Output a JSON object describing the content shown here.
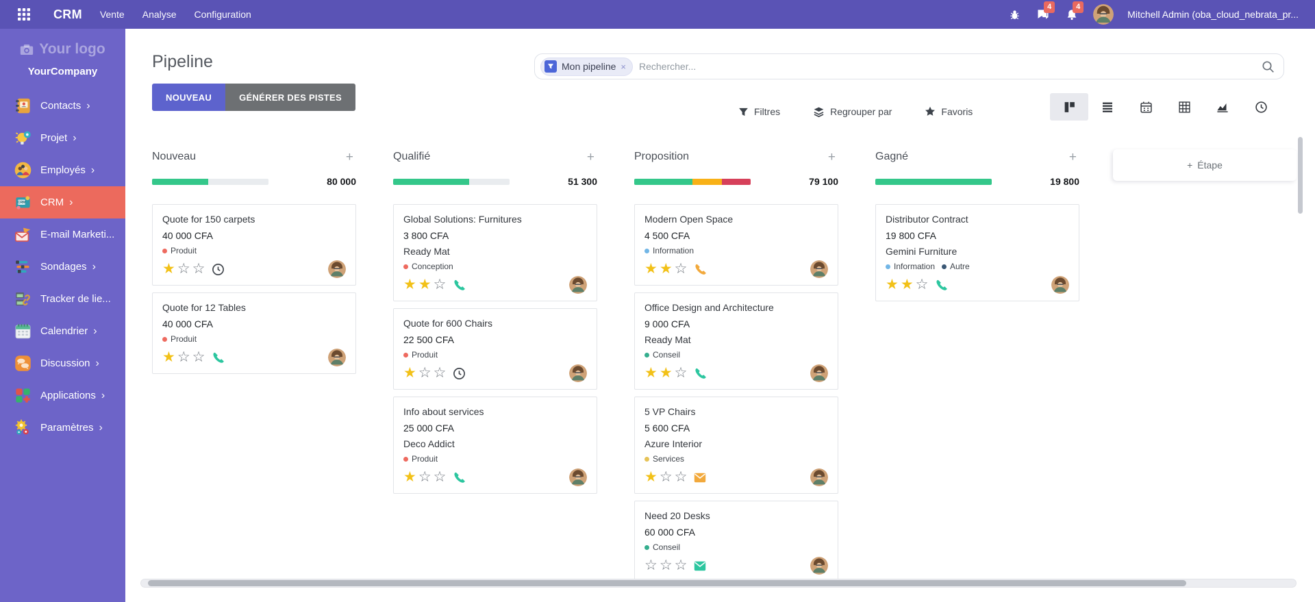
{
  "topbar": {
    "app_name": "CRM",
    "menus": [
      "Vente",
      "Analyse",
      "Configuration"
    ],
    "message_badge": "4",
    "notification_badge": "4",
    "user_name": "Mitchell Admin (oba_cloud_nebrata_pr...",
    "bar_color": "#5a53b5",
    "badge_color": "#e9695f"
  },
  "sidebar": {
    "logo_label": "Your logo",
    "company_name": "YourCompany",
    "background_color": "#6d64c8",
    "active_color": "#ec6a5d",
    "items": [
      {
        "label": "Contacts",
        "icon": "contacts-icon",
        "arrow": true,
        "active": false
      },
      {
        "label": "Projet",
        "icon": "project-icon",
        "arrow": true,
        "active": false
      },
      {
        "label": "Employés",
        "icon": "employees-icon",
        "arrow": true,
        "active": false
      },
      {
        "label": "CRM",
        "icon": "crm-icon",
        "arrow": true,
        "active": true
      },
      {
        "label": "E-mail Marketi...",
        "icon": "email-marketing-icon",
        "arrow": false,
        "active": false
      },
      {
        "label": "Sondages",
        "icon": "surveys-icon",
        "arrow": true,
        "active": false
      },
      {
        "label": "Tracker de lie...",
        "icon": "link-tracker-icon",
        "arrow": false,
        "active": false
      },
      {
        "label": "Calendrier",
        "icon": "calendar-icon",
        "arrow": true,
        "active": false
      },
      {
        "label": "Discussion",
        "icon": "discuss-icon",
        "arrow": true,
        "active": false
      },
      {
        "label": "Applications",
        "icon": "applications-icon",
        "arrow": true,
        "active": false
      },
      {
        "label": "Paramètres",
        "icon": "settings-icon",
        "arrow": true,
        "active": false
      }
    ]
  },
  "header": {
    "title": "Pipeline",
    "buttons": {
      "new": "NOUVEAU",
      "generate": "GÉNÉRER DES PISTES"
    },
    "search": {
      "facet": "Mon pipeline",
      "remove": "×",
      "placeholder": "Rechercher..."
    },
    "controls": [
      {
        "label": "Filtres",
        "icon": "filter-icon"
      },
      {
        "label": "Regrouper par",
        "icon": "layers-icon"
      },
      {
        "label": "Favoris",
        "icon": "favorite-star-icon"
      }
    ],
    "views": [
      "kanban",
      "list",
      "calendar",
      "pivot",
      "graph",
      "activity"
    ],
    "active_view": "kanban"
  },
  "kanban": {
    "add_stage": {
      "plus": "+",
      "label": "Étape"
    },
    "add_card_plus": "+",
    "max_stars": 3,
    "glyphs": {
      "star_filled": "★",
      "star_empty": "☆"
    },
    "progress_colors": {
      "green": "#34c78a",
      "orange": "#f8b117",
      "red": "#d6405a"
    },
    "tag_colors": {
      "red": "#ee6a5f",
      "lightblue": "#72b6e6",
      "teal": "#35ae8e",
      "yellow": "#e6c357",
      "navy": "#3b5875"
    },
    "activity_colors": {
      "gray": "#41464d",
      "green": "#2cc69f",
      "orange": "#f2a93c"
    },
    "columns": [
      {
        "name": "Nouveau",
        "total": "80 000",
        "progress": [
          {
            "color": "green",
            "pct": 48
          }
        ],
        "cards": [
          {
            "title": "Quote for 150 carpets",
            "amount": "40 000 CFA",
            "tags": [
              {
                "label": "Produit",
                "color": "red"
              }
            ],
            "stars": 1,
            "activity": {
              "type": "clock",
              "color": "gray"
            }
          },
          {
            "title": "Quote for 12 Tables",
            "amount": "40 000 CFA",
            "tags": [
              {
                "label": "Produit",
                "color": "red"
              }
            ],
            "stars": 1,
            "activity": {
              "type": "phone",
              "color": "green"
            }
          }
        ]
      },
      {
        "name": "Qualifié",
        "total": "51 300",
        "progress": [
          {
            "color": "green",
            "pct": 65
          }
        ],
        "cards": [
          {
            "title": "Global Solutions: Furnitures",
            "amount": "3 800 CFA",
            "partner": "Ready Mat",
            "tags": [
              {
                "label": "Conception",
                "color": "red"
              }
            ],
            "stars": 2,
            "activity": {
              "type": "phone",
              "color": "green"
            }
          },
          {
            "title": "Quote for 600 Chairs",
            "amount": "22 500 CFA",
            "tags": [
              {
                "label": "Produit",
                "color": "red"
              }
            ],
            "stars": 1,
            "activity": {
              "type": "clock",
              "color": "gray"
            }
          },
          {
            "title": "Info about services",
            "amount": "25 000 CFA",
            "partner": "Deco Addict",
            "tags": [
              {
                "label": "Produit",
                "color": "red"
              }
            ],
            "stars": 1,
            "activity": {
              "type": "phone",
              "color": "green"
            }
          }
        ]
      },
      {
        "name": "Proposition",
        "total": "79 100",
        "progress": [
          {
            "color": "green",
            "pct": 50
          },
          {
            "color": "orange",
            "pct": 25
          },
          {
            "color": "red",
            "pct": 25
          }
        ],
        "cards": [
          {
            "title": "Modern Open Space",
            "amount": "4 500 CFA",
            "tags": [
              {
                "label": "Information",
                "color": "lightblue"
              }
            ],
            "stars": 2,
            "activity": {
              "type": "phone",
              "color": "orange"
            }
          },
          {
            "title": "Office Design and Architecture",
            "amount": "9 000 CFA",
            "partner": "Ready Mat",
            "tags": [
              {
                "label": "Conseil",
                "color": "teal"
              }
            ],
            "stars": 2,
            "activity": {
              "type": "phone",
              "color": "green"
            }
          },
          {
            "title": "5 VP Chairs",
            "amount": "5 600 CFA",
            "partner": "Azure Interior",
            "tags": [
              {
                "label": "Services",
                "color": "yellow"
              }
            ],
            "stars": 1,
            "activity": {
              "type": "mail",
              "color": "orange"
            }
          },
          {
            "title": "Need 20 Desks",
            "amount": "60 000 CFA",
            "tags": [
              {
                "label": "Conseil",
                "color": "teal"
              }
            ],
            "stars": 0,
            "activity": {
              "type": "mail",
              "color": "green"
            }
          }
        ]
      },
      {
        "name": "Gagné",
        "total": "19 800",
        "progress": [
          {
            "color": "green",
            "pct": 100
          }
        ],
        "cards": [
          {
            "title": "Distributor Contract",
            "amount": "19 800 CFA",
            "partner": "Gemini Furniture",
            "tags": [
              {
                "label": "Information",
                "color": "lightblue"
              },
              {
                "label": "Autre",
                "color": "navy"
              }
            ],
            "stars": 2,
            "activity": {
              "type": "phone",
              "color": "green"
            }
          }
        ]
      }
    ]
  }
}
